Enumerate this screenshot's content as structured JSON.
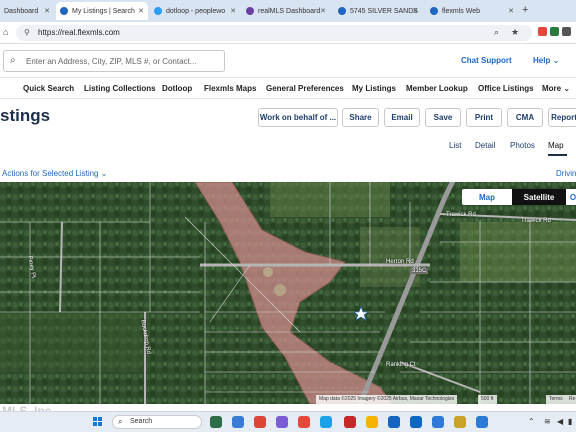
{
  "browser": {
    "tabs": [
      {
        "label": "Dashboard",
        "active": false
      },
      {
        "label": "My Listings | Search",
        "active": true
      },
      {
        "label": "dotloop - peoplewo",
        "active": false
      },
      {
        "label": "realMLS Dashboard",
        "active": false
      },
      {
        "label": "5745 SILVER SANDS",
        "active": false
      },
      {
        "label": "flexmls Web",
        "active": false
      }
    ],
    "new_tab": "+",
    "url": "https://real.flexmls.com"
  },
  "header": {
    "search_placeholder": "Enter an Address, City, ZIP, MLS #, or Contact...",
    "chat_support": "Chat Support",
    "help": "Help"
  },
  "nav": {
    "items": [
      "Quick Search",
      "Listing Collections",
      "Dotloop",
      "Flexmls Maps",
      "General Preferences",
      "My Listings",
      "Member Lookup",
      "Office Listings",
      "More"
    ]
  },
  "page": {
    "title": "stings",
    "buttons": [
      "Work on behalf of ...",
      "Share",
      "Email",
      "Save",
      "Print",
      "CMA",
      "Report"
    ],
    "view_tabs": [
      "List",
      "Detail",
      "Photos",
      "Map"
    ],
    "active_view": "Map",
    "actions_label": "Actions for Selected Listing",
    "driving_label": "Drivin"
  },
  "map": {
    "type_buttons": [
      "Map",
      "Satellite"
    ],
    "active_type": "Satellite",
    "overflow_btn": "O",
    "labels": {
      "trawick1": "Trawick Rd",
      "trawick2": "Trawick Rd",
      "herron": "Herron Rd",
      "route": "315C",
      "piney": "Piney Pt",
      "buckdrop": "Buckdrop Rd",
      "ranking": "Ranking Ct"
    },
    "credits": "Map data ©2025 Imagery ©2025 Airbus, Maxar Technologies",
    "scale": "500 ft",
    "terms": "Terms",
    "report": "Re",
    "accent": "#cf8b8b",
    "listing_marker_color": "#ffffff"
  },
  "watermark": "MLS, Inc",
  "taskbar": {
    "search_label": "Search"
  }
}
